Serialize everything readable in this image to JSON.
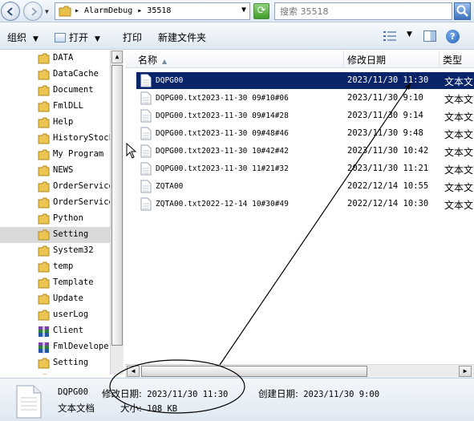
{
  "address": {
    "breadcrumb": "▸ AlarmDebug ▸ 35518",
    "search_placeholder": "搜索 35518"
  },
  "toolbar": {
    "organize": "组织",
    "open": "打开",
    "print": "打印",
    "new_folder": "新建文件夹"
  },
  "tree": [
    {
      "label": "DATA",
      "icon": "folder"
    },
    {
      "label": "DataCache",
      "icon": "folder"
    },
    {
      "label": "Document",
      "icon": "folder"
    },
    {
      "label": "FmlDLL",
      "icon": "folder"
    },
    {
      "label": "Help",
      "icon": "folder"
    },
    {
      "label": "HistoryStock",
      "icon": "folder"
    },
    {
      "label": "My Program",
      "icon": "folder"
    },
    {
      "label": "NEWS",
      "icon": "folder"
    },
    {
      "label": "OrderService",
      "icon": "folder"
    },
    {
      "label": "OrderService",
      "icon": "folder"
    },
    {
      "label": "Python",
      "icon": "folder"
    },
    {
      "label": "Setting",
      "icon": "folder",
      "selected": true
    },
    {
      "label": "System32",
      "icon": "folder"
    },
    {
      "label": "temp",
      "icon": "folder"
    },
    {
      "label": "Template",
      "icon": "folder"
    },
    {
      "label": "Update",
      "icon": "folder"
    },
    {
      "label": "userLog",
      "icon": "folder"
    },
    {
      "label": "Client",
      "icon": "archive"
    },
    {
      "label": "FmlDevelope",
      "icon": "archive"
    },
    {
      "label": "Setting",
      "icon": "folder"
    },
    {
      "label": "OrderI...",
      "icon": "folder"
    }
  ],
  "columns": {
    "name": "名称",
    "date": "修改日期",
    "type": "类型"
  },
  "files": [
    {
      "name": "DQPG00",
      "date": "2023/11/30 11:30",
      "type": "文本文",
      "selected": true
    },
    {
      "name": "DQPG00.txt2023-11-30 09#10#06",
      "date": "2023/11/30 9:10",
      "type": "文本文"
    },
    {
      "name": "DQPG00.txt2023-11-30 09#14#28",
      "date": "2023/11/30 9:14",
      "type": "文本文"
    },
    {
      "name": "DQPG00.txt2023-11-30 09#48#46",
      "date": "2023/11/30 9:48",
      "type": "文本文"
    },
    {
      "name": "DQPG00.txt2023-11-30 10#42#42",
      "date": "2023/11/30 10:42",
      "type": "文本文"
    },
    {
      "name": "DQPG00.txt2023-11-30 11#21#32",
      "date": "2023/11/30 11:21",
      "type": "文本文"
    },
    {
      "name": "ZQTA00",
      "date": "2022/12/14 10:55",
      "type": "文本文"
    },
    {
      "name": "ZQTA00.txt2022-12-14 10#30#49",
      "date": "2022/12/14 10:30",
      "type": "文本文"
    }
  ],
  "details": {
    "filename": "DQPG00",
    "filetype": "文本文档",
    "modified_label": "修改日期:",
    "modified_value": "2023/11/30 11:30",
    "created_label": "创建日期:",
    "created_value": "2023/11/30 9:00",
    "size_label": "大小:",
    "size_value": "108 KB"
  },
  "colors": {
    "selection": "#0a246a",
    "annotation": "#000000"
  }
}
